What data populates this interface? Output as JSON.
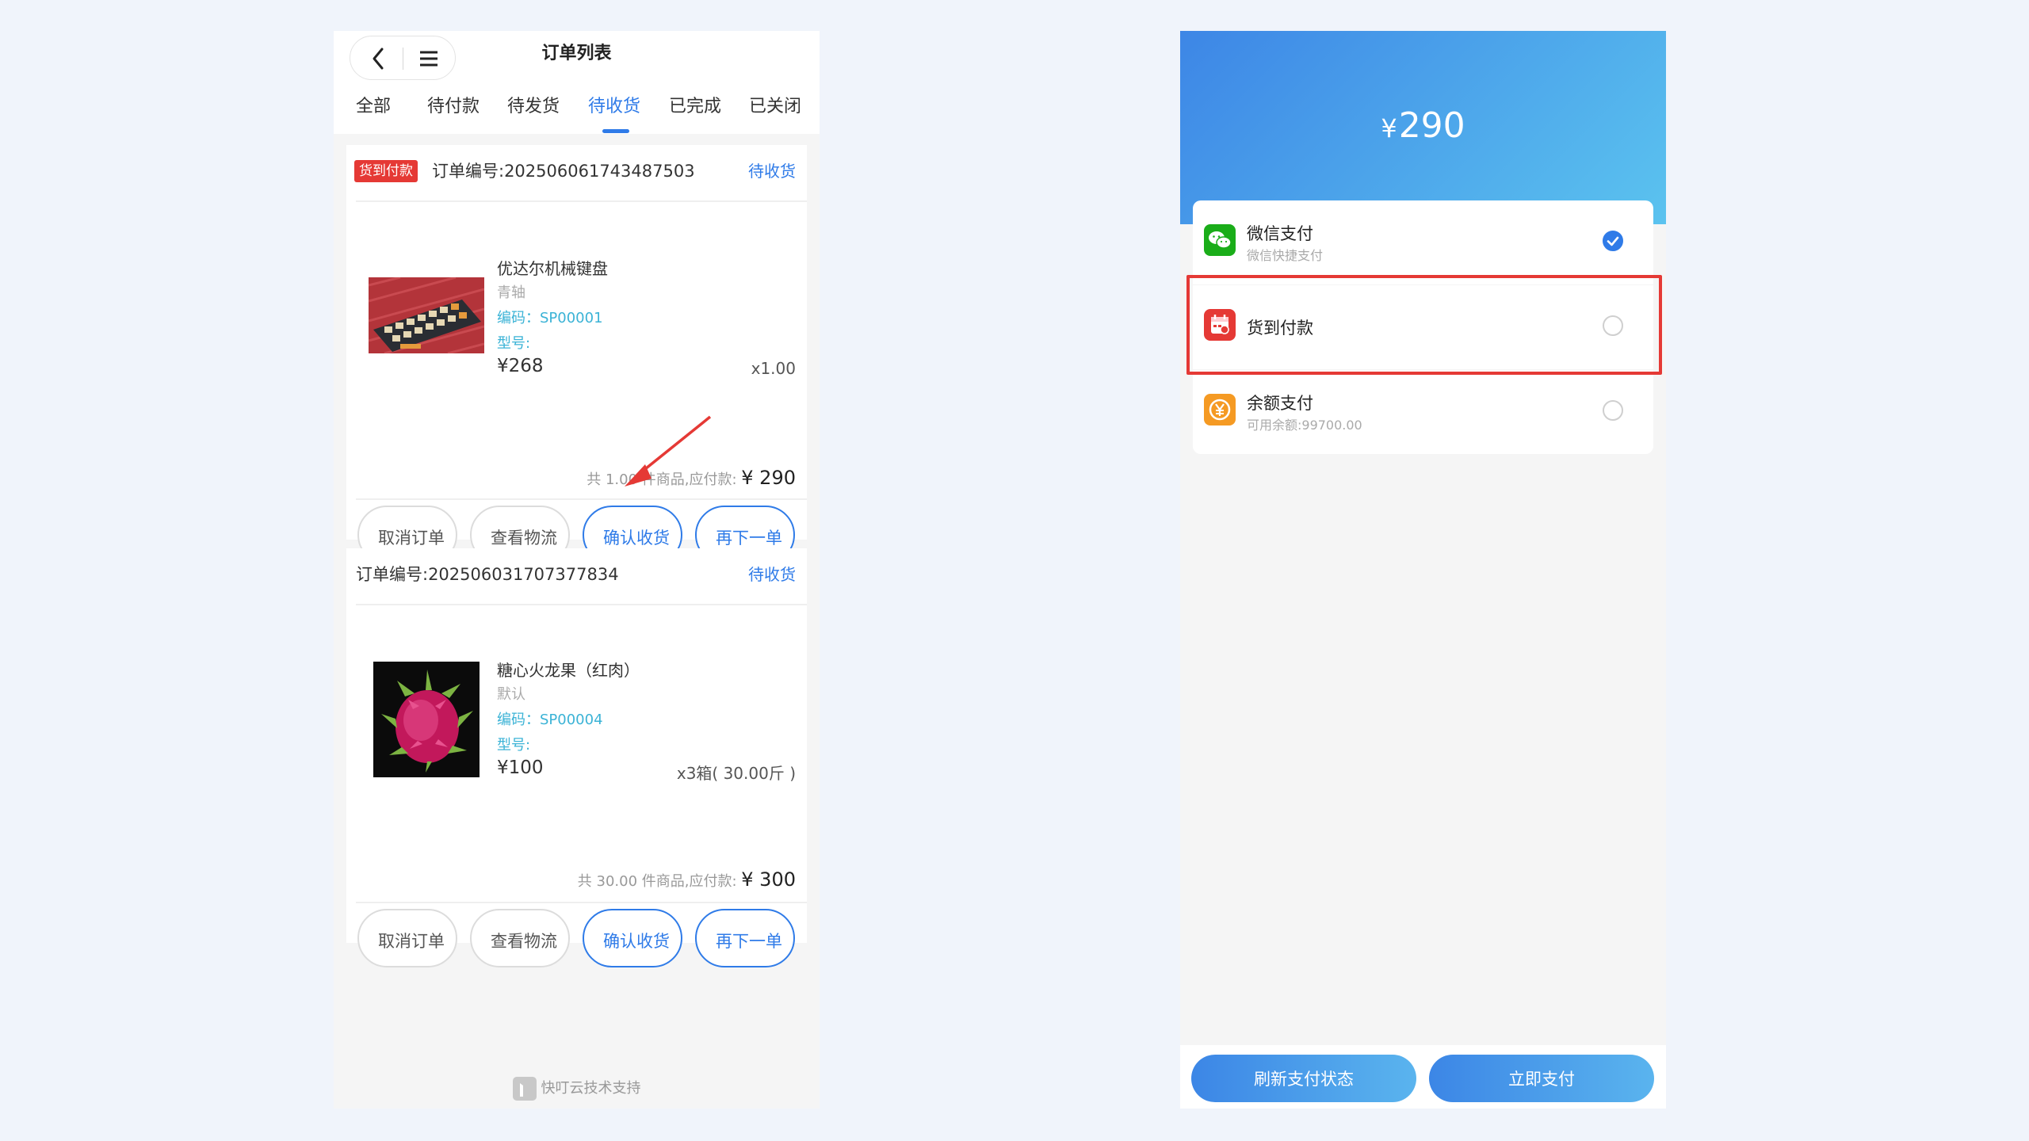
{
  "order_list": {
    "title": "订单列表",
    "tabs": [
      {
        "label": "全部"
      },
      {
        "label": "待付款"
      },
      {
        "label": "待发货"
      },
      {
        "label": "待收货"
      },
      {
        "label": "已完成"
      },
      {
        "label": "已关闭"
      }
    ],
    "active_tab": "待收货",
    "orders": [
      {
        "tag": "货到付款",
        "order_no": "订单编号:2025060617434875­03",
        "status": "待收货",
        "product": {
          "name": "优达尔机械键盘",
          "spec": "青轴",
          "code": "编码：SP00001",
          "model": "型号:",
          "price": "¥268",
          "qty": "x1.00"
        },
        "summary_text": "共 1.00 件商品,应付款: ",
        "summary_amount": "¥ 290",
        "buttons": [
          "取消订单",
          "查看物流",
          "确认收货",
          "再下一单"
        ]
      },
      {
        "order_no": "订单编号:202506031707377834",
        "status": "待收货",
        "product": {
          "name": "糖心火龙果（红肉）",
          "spec": "默认",
          "code": "编码：SP00004",
          "model": "型号:",
          "price": "¥100",
          "qty": "x3箱( 30.00斤 )"
        },
        "summary_text": "共 30.00 件商品,应付款: ",
        "summary_amount": "¥ 300",
        "buttons": [
          "取消订单",
          "查看物流",
          "确认收货",
          "再下一单"
        ]
      }
    ],
    "powered_by": "快叮云技术支持"
  },
  "payment": {
    "amount_symbol": "¥",
    "amount": "290",
    "options": [
      {
        "title": "微信支付",
        "subtitle": "微信快捷支付",
        "icon": "wechat-icon",
        "selected": true
      },
      {
        "title": "货到付款",
        "subtitle": "",
        "icon": "cod-calendar-icon",
        "selected": false
      },
      {
        "title": "余额支付",
        "subtitle": "可用余额:99700.00",
        "icon": "yuan-coin-icon",
        "selected": false
      }
    ],
    "refresh_label": "刷新支付状态",
    "pay_label": "立即支付"
  },
  "colors": {
    "accent": "#2f7be8",
    "code_text": "#3bb3d6",
    "cod_tag": "#e53935",
    "wechat_green": "#1aad19",
    "balance_orange": "#f59a23"
  }
}
